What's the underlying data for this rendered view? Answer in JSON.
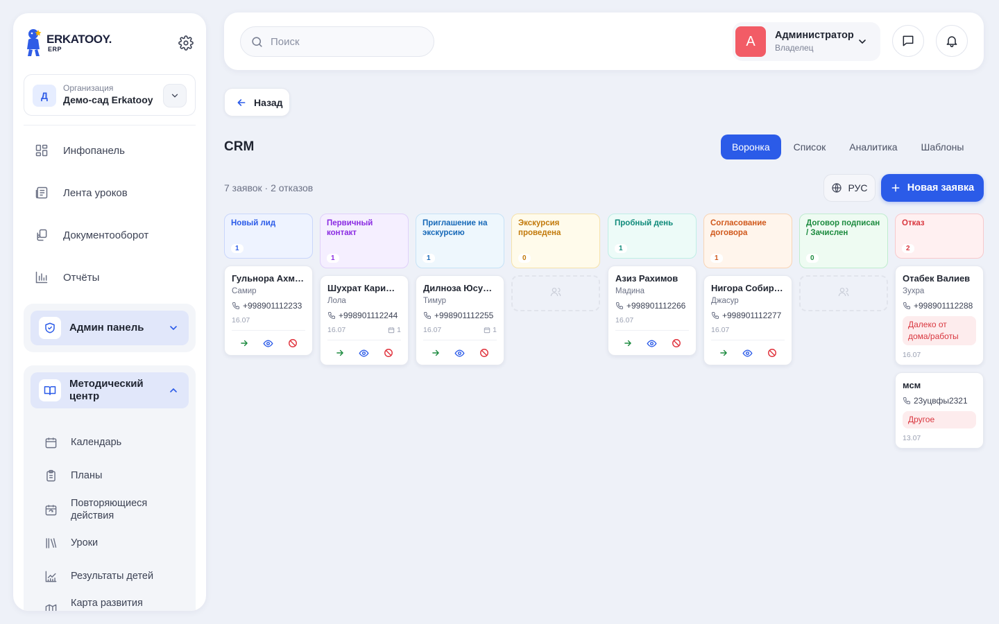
{
  "brand": {
    "name": "ERKATOOY.",
    "sub": "ERP"
  },
  "org": {
    "label": "Организация",
    "name": "Демо-сад Erkatooy",
    "initial": "Д"
  },
  "nav": [
    {
      "label": "Инфопанель",
      "icon": "dashboard-icon"
    },
    {
      "label": "Лента уроков",
      "icon": "lessons-feed-icon"
    },
    {
      "label": "Документооборот",
      "icon": "documents-icon"
    },
    {
      "label": "Отчёты",
      "icon": "reports-icon"
    }
  ],
  "admin_group": {
    "label": "Админ панель",
    "expanded": false
  },
  "method_group": {
    "label": "Методический центр",
    "expanded": true,
    "items": [
      {
        "label": "Календарь",
        "icon": "calendar-icon"
      },
      {
        "label": "Планы",
        "icon": "clipboard-icon"
      },
      {
        "label": "Повторяющиеся действия",
        "icon": "recurring-icon"
      },
      {
        "label": "Уроки",
        "icon": "library-icon"
      },
      {
        "label": "Результаты детей",
        "icon": "results-chart-icon"
      },
      {
        "label": "Карта развития ребенка",
        "icon": "map-icon"
      }
    ]
  },
  "search": {
    "placeholder": "Поиск"
  },
  "user": {
    "initial": "A",
    "name": "Администратор",
    "role": "Владелец"
  },
  "back_label": "Назад",
  "page_title": "CRM",
  "tabs": [
    {
      "label": "Воронка",
      "active": true
    },
    {
      "label": "Список",
      "active": false
    },
    {
      "label": "Аналитика",
      "active": false
    },
    {
      "label": "Шаблоны",
      "active": false
    }
  ],
  "summary": "7 заявок · 2 отказов",
  "lang_label": "РУС",
  "new_button_label": "Новая заявка",
  "columns": [
    {
      "title": "Новый лид",
      "count": "1",
      "color": "#2b5be8",
      "bg": "#eef3ff",
      "border": "#c9d6fb",
      "cards": [
        {
          "name": "Гульнора Ахме…",
          "sub": "Самир",
          "phone": "+998901112233",
          "date": "16.07"
        }
      ]
    },
    {
      "title": "Первичный контакт",
      "count": "1",
      "color": "#8a2be2",
      "bg": "#f5efff",
      "border": "#e0d0fa",
      "cards": [
        {
          "name": "Шухрат Карим…",
          "sub": "Лола",
          "phone": "+998901112244",
          "date": "16.07",
          "tasks": "1"
        }
      ]
    },
    {
      "title": "Приглашение на экскурсию",
      "count": "1",
      "color": "#1769b8",
      "bg": "#eef7fd",
      "border": "#c6e2f6",
      "cards": [
        {
          "name": "Дилноза Юсуп…",
          "sub": "Тимур",
          "phone": "+998901112255",
          "date": "16.07",
          "tasks": "1"
        }
      ]
    },
    {
      "title": "Экскурсия проведена",
      "count": "0",
      "color": "#c2790a",
      "bg": "#fffbeb",
      "border": "#f6e2a9",
      "cards": []
    },
    {
      "title": "Пробный день",
      "count": "1",
      "color": "#0f8a7a",
      "bg": "#edfbf8",
      "border": "#bfeee5",
      "cards": [
        {
          "name": "Азиз Рахимов",
          "sub": "Мадина",
          "phone": "+998901112266",
          "date": "16.07"
        }
      ]
    },
    {
      "title": "Согласование договора",
      "count": "1",
      "color": "#d0571a",
      "bg": "#fff5ec",
      "border": "#f8d4b5",
      "cards": [
        {
          "name": "Нигора Собиро…",
          "sub": "Джасур",
          "phone": "+998901112277",
          "date": "16.07"
        }
      ]
    },
    {
      "title": "Договор подписан / Зачислен",
      "count": "0",
      "color": "#1b8a3e",
      "bg": "#eefbf2",
      "border": "#bfecce",
      "cards": []
    },
    {
      "title": "Отказ",
      "count": "2",
      "color": "#d9363e",
      "bg": "#fff0f1",
      "border": "#f7c9cc",
      "cards": [
        {
          "name": "Отабек Валиев",
          "sub": "Зухра",
          "phone": "+998901112288",
          "reason": "Далеко от дома/работы",
          "date": "16.07"
        },
        {
          "name": "мсм",
          "phone": "23уцвфы2321",
          "reason": "Другое",
          "date": "13.07"
        }
      ]
    }
  ]
}
